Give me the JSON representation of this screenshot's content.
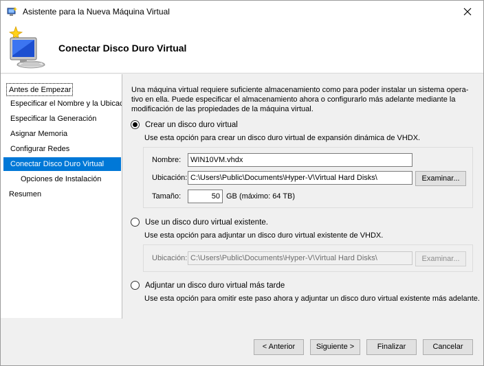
{
  "window": {
    "title": "Asistente para la Nueva Máquina Virtual",
    "close_icon": "close-icon"
  },
  "header": {
    "title": "Conectar Disco Duro Virtual",
    "icon": "new-vm-wizard-icon"
  },
  "nav": {
    "items": [
      {
        "label": "Antes de Empezar",
        "state": "focused"
      },
      {
        "label": "Especificar el Nombre y la Ubicación",
        "state": "normal"
      },
      {
        "label": "Especificar la Generación",
        "state": "normal"
      },
      {
        "label": "Asignar Memoria",
        "state": "normal"
      },
      {
        "label": "Configurar Redes",
        "state": "normal"
      },
      {
        "label": "Conectar Disco Duro Virtual",
        "state": "selected"
      },
      {
        "label": "Opciones de Instalación",
        "state": "sub"
      },
      {
        "label": "Resumen",
        "state": "normal"
      }
    ]
  },
  "content": {
    "intro": "Una máquina virtual requiere suficiente almacenamiento como para poder instalar un sistema opera-tivo en ella. Puede especificar el almacenamiento ahora o configurarlo más adelante mediante la modificación de las propiedades de la máquina virtual.",
    "intro_lines": [
      "Una máquina virtual requiere suficiente almacenamiento como para poder instalar un sistema opera-",
      "tivo en ella. Puede especificar el almacenamiento ahora o configurarlo más adelante mediante la",
      "modificación de las propiedades de la máquina virtual."
    ],
    "option_create": {
      "label": "Crear un disco duro virtual",
      "checked": true,
      "description": "Use esta opción para crear un disco duro virtual de expansión dinámica de VHDX.",
      "name_label": "Nombre:",
      "name_value": "WIN10VM.vhdx",
      "location_label": "Ubicación:",
      "location_value": "C:\\Users\\Public\\Documents\\Hyper-V\\Virtual Hard Disks\\",
      "browse_label": "Examinar...",
      "size_label": "Tamaño:",
      "size_value": "50",
      "size_suffix": "GB (máximo: 64 TB)"
    },
    "option_existing": {
      "label": "Use un disco duro virtual existente.",
      "checked": false,
      "description": "Use esta opción para adjuntar un disco duro virtual existente de VHDX.",
      "location_label": "Ubicación:",
      "location_value": "C:\\Users\\Public\\Documents\\Hyper-V\\Virtual Hard Disks\\",
      "browse_label": "Examinar..."
    },
    "option_later": {
      "label": "Adjuntar un disco duro virtual más tarde",
      "checked": false,
      "description": "Use esta opción para omitir este paso ahora y adjuntar un disco duro virtual existente más adelante."
    }
  },
  "footer": {
    "previous": "< Anterior",
    "next": "Siguiente >",
    "finish": "Finalizar",
    "cancel": "Cancelar"
  }
}
